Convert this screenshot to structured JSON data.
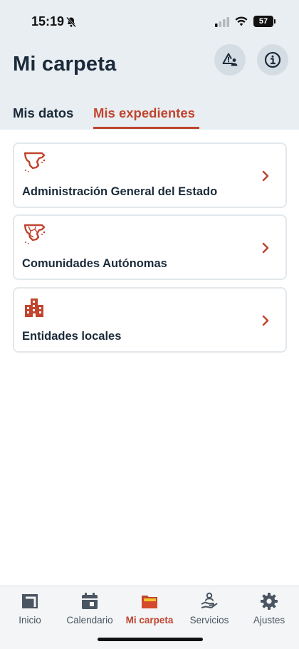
{
  "status_bar": {
    "time": "15:19",
    "battery": "57"
  },
  "header": {
    "title": "Mi carpeta",
    "alert_icon": "warning-user-icon",
    "info_icon": "info-icon"
  },
  "tabs": [
    {
      "label": "Mis datos",
      "active": false
    },
    {
      "label": "Mis expedientes",
      "active": true
    }
  ],
  "cards": [
    {
      "label": "Administración General del Estado",
      "icon": "spain-map-icon"
    },
    {
      "label": "Comunidades Autónomas",
      "icon": "regions-map-icon"
    },
    {
      "label": "Entidades locales",
      "icon": "buildings-icon"
    }
  ],
  "tabbar": {
    "items": [
      {
        "label": "Inicio",
        "icon": "home-icon",
        "active": false
      },
      {
        "label": "Calendario",
        "icon": "calendar-icon",
        "active": false
      },
      {
        "label": "Mi carpeta",
        "icon": "folder-icon",
        "active": true
      },
      {
        "label": "Servicios",
        "icon": "services-icon",
        "active": false
      },
      {
        "label": "Ajustes",
        "icon": "gear-icon",
        "active": false
      }
    ]
  },
  "colors": {
    "accent": "#c0452f",
    "header_bg": "#e9eef2",
    "text": "#1b2a3a"
  }
}
